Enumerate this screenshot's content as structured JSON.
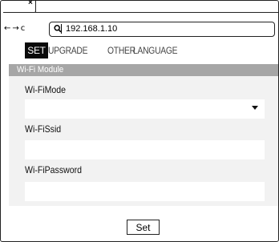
{
  "browser": {
    "tab_close": "×",
    "nav": {
      "back": "←",
      "forward": "→",
      "reload": "c"
    },
    "address": "192.168.1.10"
  },
  "menu": {
    "set": "SET",
    "upgrade": "UPGRADE",
    "other": "OTHER",
    "language": "LANGUAGE"
  },
  "module": {
    "title": "Wi-Fi Module",
    "fields": {
      "mode_label": "Wi-FiMode",
      "mode_value": "",
      "ssid_label": "Wi-FiSsid",
      "ssid_value": "",
      "password_label": "Wi-FiPassword",
      "password_value": ""
    }
  },
  "actions": {
    "set_label": "Set"
  },
  "colors": {
    "header_bg": "#a6a6a6",
    "form_bg": "#f2f2f2",
    "active_menu_bg": "#0a0a0a"
  }
}
